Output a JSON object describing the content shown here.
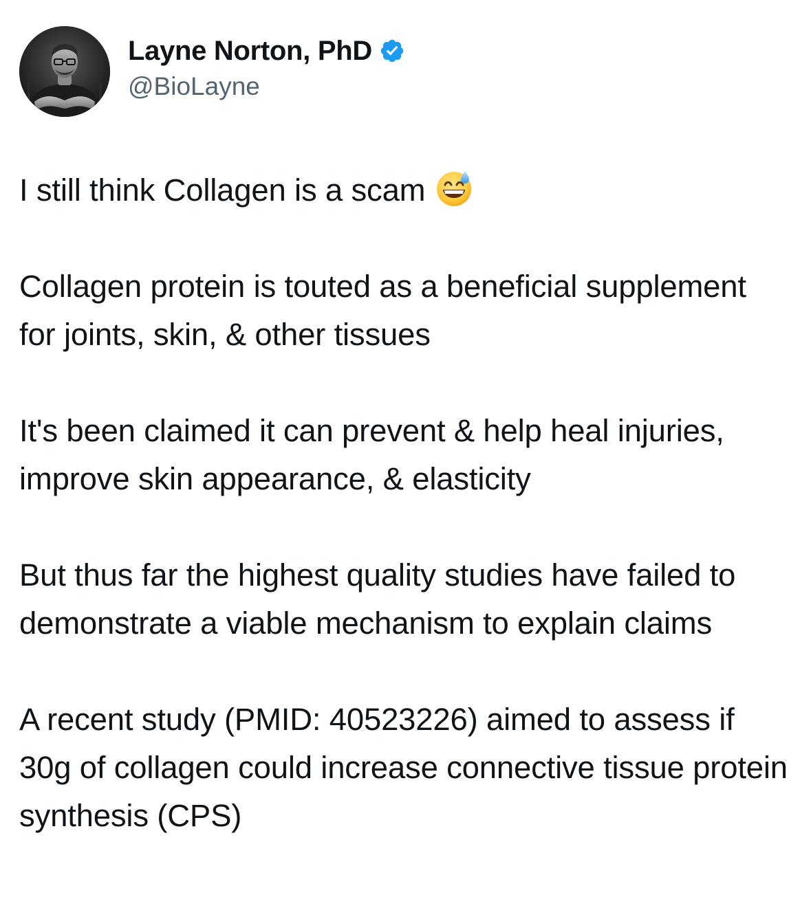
{
  "author": {
    "display_name": "Layne Norton, PhD",
    "handle": "@BioLayne",
    "verified": true,
    "verified_color": "#1d9bf0",
    "avatar_icon": "profile-photo"
  },
  "tweet": {
    "first_line": "I still think Collagen is a scam",
    "first_line_emoji": "grinning-face-with-sweat-emoji",
    "paragraphs": [
      "Collagen protein is touted as a beneficial supplement for joints, skin, & other tissues",
      "It's been claimed it can prevent & help heal injuries, improve skin appearance, & elasticity",
      "But thus far the highest quality studies have failed to demonstrate a viable mechanism to explain claims",
      "A recent study (PMID: 40523226) aimed to assess if 30g of collagen could increase connective tissue protein synthesis (CPS)"
    ]
  },
  "colors": {
    "text": "#0f1419",
    "secondary_text": "#536471",
    "background": "#ffffff"
  }
}
